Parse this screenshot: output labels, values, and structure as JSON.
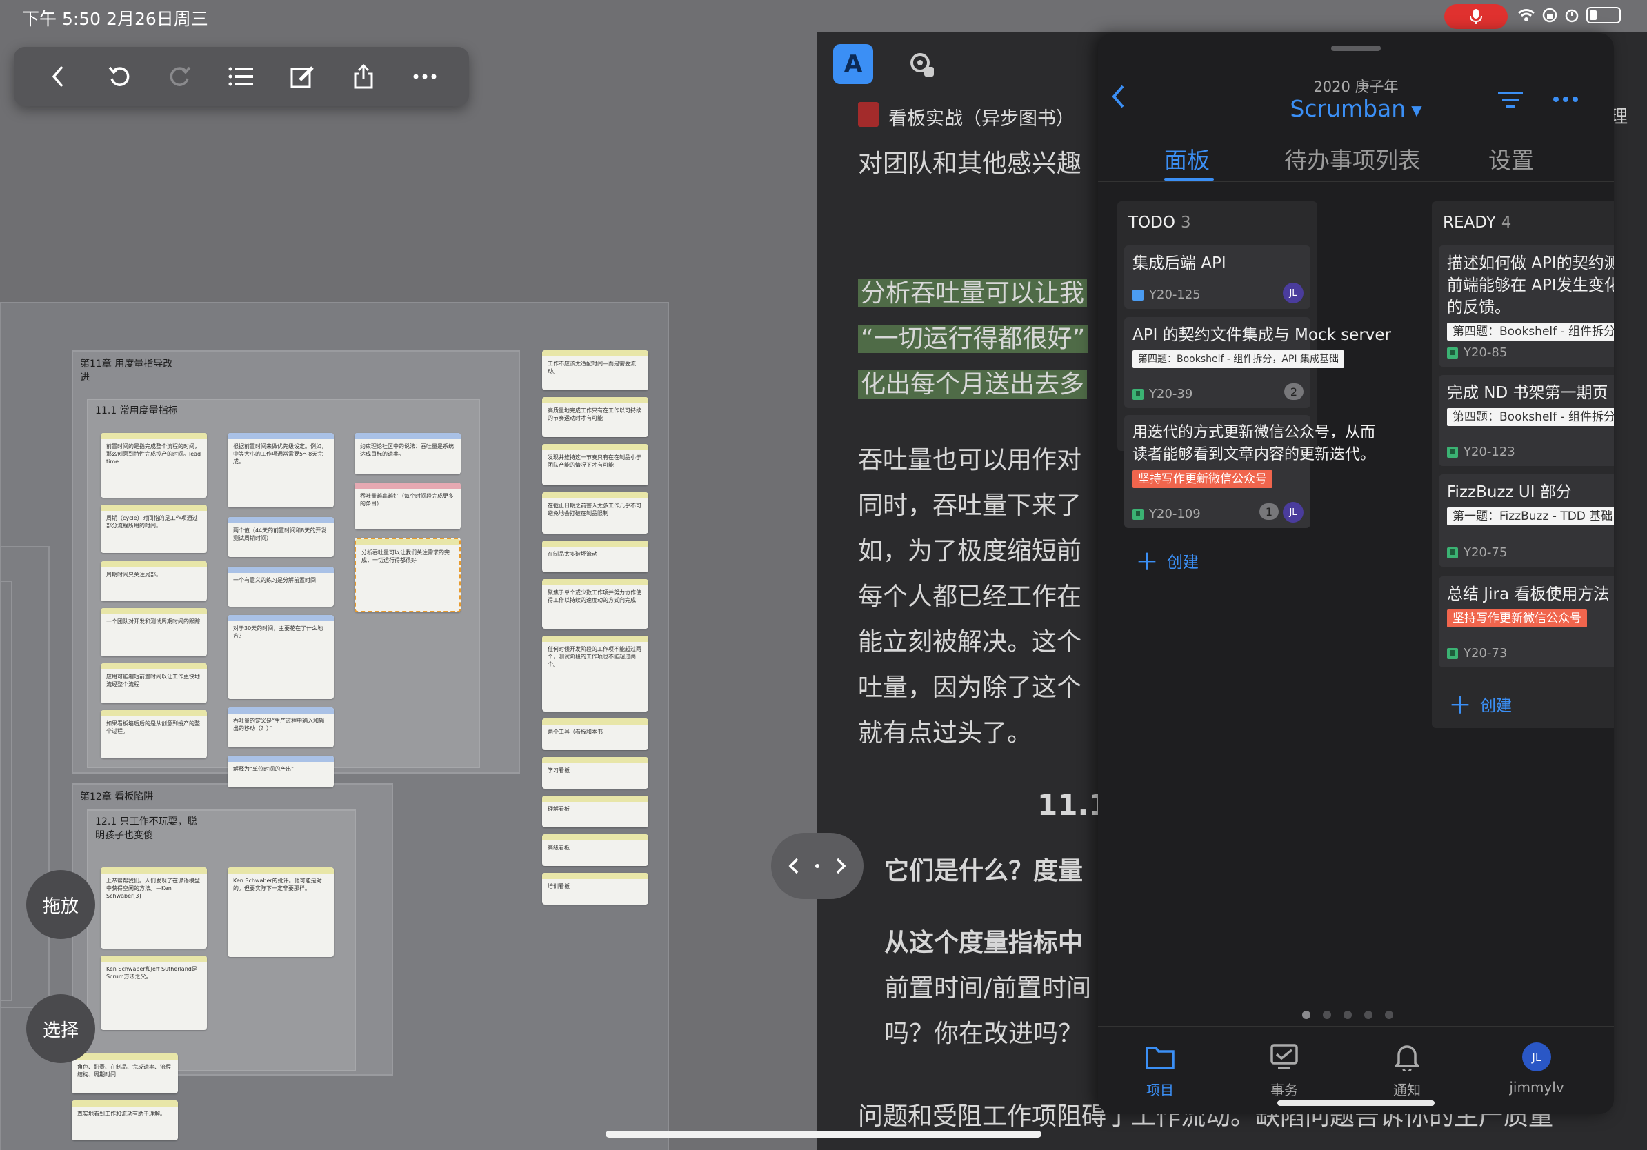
{
  "status": {
    "time": "下午 5:50   2月26日周三"
  },
  "left_app": {
    "float_drag": "拖放",
    "float_select": "选择",
    "ch11_title": "第11章 用度量指导改进",
    "ch11_sub": "11.1 常用度量指标",
    "ch12_title": "第12章 看板陷阱",
    "ch12_sub": "12.1 只工作不玩耍，聪明孩子也变傻",
    "minis": [
      "前置时间的是指完成整个流程的时间，那么创意到特性完成投产的时间。lead time",
      "根据前置时间来做优先级设定。例如，中等大小的工作项通常需要5～8天完成。",
      "约束理论社区中的说法：吞吐量是系统达成目标的速率。",
      "周期（cycle）时间指的是工作项通过部分流程所用的时间。",
      "吞吐量越高越好（每个时间段完成更多的条目）",
      "两个值（44天的前置时间和8天的开发测试周期时间）",
      "分析吞吐量可以让我们关注需求的完成，一切运行得都很好",
      "周期时间只关注局部。",
      "一个有意义的练习是分解前置时间",
      "一个团队对开发和测试周期时间的跟踪",
      "对于30天的时间，主要花在了什么地方？",
      "应用可能缩短前置时间以让工作更快地流经整个流程",
      "吞吐量的定义是“生产过程中输入和输出的移动（？）”",
      "如果看板墙后后的是从创意到投产的整个过程。",
      "解释为“单位时间的产出”",
      "工作不应该太适配时间—而是需要流动。",
      "高质量地完成工作只有在工作以可持续的节奏运动时才有可能",
      "发现并维持这一节奏只有在在制品小于团队产能的情况下才有可能",
      "在截止日期之前塞入太多工作几乎不可避免地会打破在制品限制",
      "在制品太多破坏流动",
      "聚焦于单个或少数工作项并努力协作使得工作以持续的速度动的方式向完成",
      "任何时候开发阶段的工作项不能超过两个，测试阶段的工作项也不能超过两个。",
      "两个工具（看板和本书",
      "学习看板",
      "理解看板",
      "高级看板",
      "培训看板",
      "上帝帮帮我们。人们发现了在谚语模型中获得空闲的方法。—Ken Schwaber[3]",
      "Ken Schwaber的批评。他可能是对的。但要实际下一定非要那样。",
      "Ken Schwaber和Jeff Sutherland是Scrum方法之父。",
      "角色、职责、在制品、完成速率、流程结构、周期时间",
      "真实地看到工作和流动有助于理解。"
    ]
  },
  "reader": {
    "book_title": "看板实战（异步图书）",
    "lines": [
      "对团队和其他感兴趣",
      "分析吞吐量可以让我",
      "“一切运行得都很好”",
      "化出每个月送出去多",
      "吞吐量也可以用作对",
      "同时，吞吐量下来了",
      "如，为了极度缩短前",
      "每个人都已经工作在",
      "能立刻被解决。这个",
      "吐量，因为除了这个",
      "就有点过头了。",
      "11.1",
      "它们是什么？度量",
      "从这个度量指标中",
      "前置时间/前置时间",
      "吗？你在改进吗？",
      "问题和受阻工作项阻碍了工作流动。缺陷问题告诉你的生产质量"
    ],
    "edge_label": "理"
  },
  "scrumban": {
    "year": "2020 庚子年",
    "project": "Scrumban",
    "tabs": [
      "面板",
      "待办事项列表",
      "设置"
    ],
    "columns": [
      {
        "name": "TODO",
        "count": "3",
        "cards": [
          {
            "title": "集成后端 API",
            "key": "Y20-125",
            "avatar": "JL"
          },
          {
            "title": "API 的契约文件集成与 Mock server",
            "tag": "第四题：Bookshelf - 组件拆分，API 集成基础",
            "key": "Y20-39",
            "badge": "2"
          },
          {
            "title1": "用迭代的方式更新微信公众号，从而",
            "title2": "读者能够看到文章内容的更新迭代。",
            "tag": "坚持写作更新微信公众号",
            "key": "Y20-109",
            "badge": "1",
            "avatar": "JL"
          }
        ],
        "create": "创建"
      },
      {
        "name": "READY",
        "count": "4",
        "cards": [
          {
            "title1": "描述如何做 API的契约测",
            "title2": "前端能够在 API发生变化",
            "title3": "的反馈。",
            "tag": "第四题：Bookshelf - 组件拆分",
            "key": "Y20-85"
          },
          {
            "title": "完成 ND 书架第一期页",
            "tag": "第四题：Bookshelf - 组件拆分",
            "key": "Y20-123"
          },
          {
            "title": "FizzBuzz UI 部分",
            "tag": "第一题：FizzBuzz - TDD 基础",
            "key": "Y20-75"
          },
          {
            "title": "总结 Jira 看板使用方法",
            "tag": "坚持写作更新微信公众号",
            "key": "Y20-73"
          }
        ],
        "create": "创建"
      }
    ],
    "nav": [
      "项目",
      "事务",
      "通知",
      "jimmylv"
    ],
    "nav_avatar": "JL"
  },
  "colors": {
    "accent": "#3b8ff5",
    "story": "#3bb273",
    "red_tag": "#f0654d",
    "highlight": "#4f6b47"
  }
}
